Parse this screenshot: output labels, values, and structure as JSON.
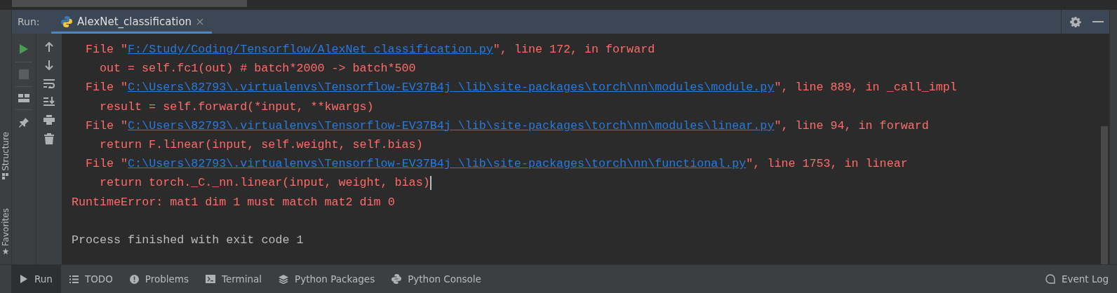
{
  "run_panel": {
    "label": "Run:",
    "tabs": [
      {
        "label": "AlexNet_classification",
        "selected": true
      }
    ]
  },
  "side_labels": [
    "Structure",
    "Favorites"
  ],
  "console": {
    "lines": [
      {
        "kind": "file",
        "prefix": "File \"",
        "link": "F:/Study/Coding/Tensorflow/AlexNet_classification.py",
        "suffix": "\", line 172, in forward"
      },
      {
        "kind": "code",
        "text": "out = self.fc1(out) # batch*2000 -> batch*500"
      },
      {
        "kind": "file",
        "prefix": "File \"",
        "link": "C:\\Users\\82793\\.virtualenvs\\Tensorflow-EV37B4j_\\lib\\site-packages\\torch\\nn\\modules\\module.py",
        "suffix": "\", line 889, in _call_impl"
      },
      {
        "kind": "code",
        "text": "result = self.forward(*input, **kwargs)"
      },
      {
        "kind": "file",
        "prefix": "File \"",
        "link": "C:\\Users\\82793\\.virtualenvs\\Tensorflow-EV37B4j_\\lib\\site-packages\\torch\\nn\\modules\\linear.py",
        "suffix": "\", line 94, in forward"
      },
      {
        "kind": "code",
        "text": "return F.linear(input, self.weight, self.bias)"
      },
      {
        "kind": "file",
        "prefix": "File \"",
        "link": "C:\\Users\\82793\\.virtualenvs\\Tensorflow-EV37B4j_\\lib\\site-packages\\torch\\nn\\functional.py",
        "suffix": "\", line 1753, in linear"
      },
      {
        "kind": "code",
        "text": "return torch._C._nn.linear(input, weight, bias)",
        "cursor": true
      },
      {
        "kind": "error",
        "text": "RuntimeError: mat1 dim 1 must match mat2 dim 0"
      },
      {
        "kind": "blank"
      },
      {
        "kind": "info",
        "text": "Process finished with exit code 1"
      }
    ]
  },
  "bottom_tabs": [
    {
      "label": "Run",
      "selected": true
    },
    {
      "label": "TODO",
      "selected": false
    },
    {
      "label": "Problems",
      "selected": false
    },
    {
      "label": "Terminal",
      "selected": false
    },
    {
      "label": "Python Packages",
      "selected": false
    },
    {
      "label": "Python Console",
      "selected": false
    }
  ],
  "event_log": "Event Log"
}
